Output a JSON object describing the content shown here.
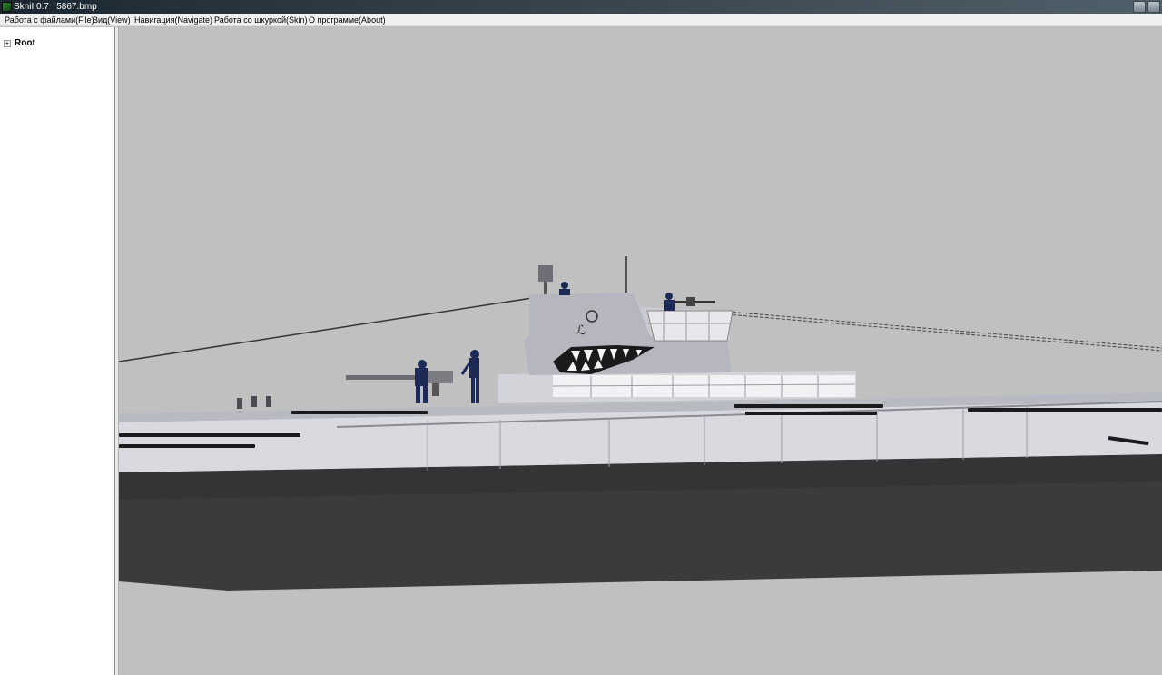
{
  "window": {
    "title": "SkniI 0.7   5867.bmp"
  },
  "menu": {
    "items": [
      "Работа с файлами(File)",
      "Вид(View)",
      "Навигация(Navigate)",
      "Работа со шкуркой(Skin)",
      "О программе(About)"
    ]
  },
  "tree": {
    "expander": "+",
    "root_label": "Root"
  },
  "viewport": {
    "background": "#c0c0c0",
    "model": "submarine"
  },
  "colors": {
    "hull_upper": "#dcdde3",
    "hull_lower": "#3a3b3d",
    "tower": "#b9bac2",
    "crew": "#1c2a55"
  }
}
